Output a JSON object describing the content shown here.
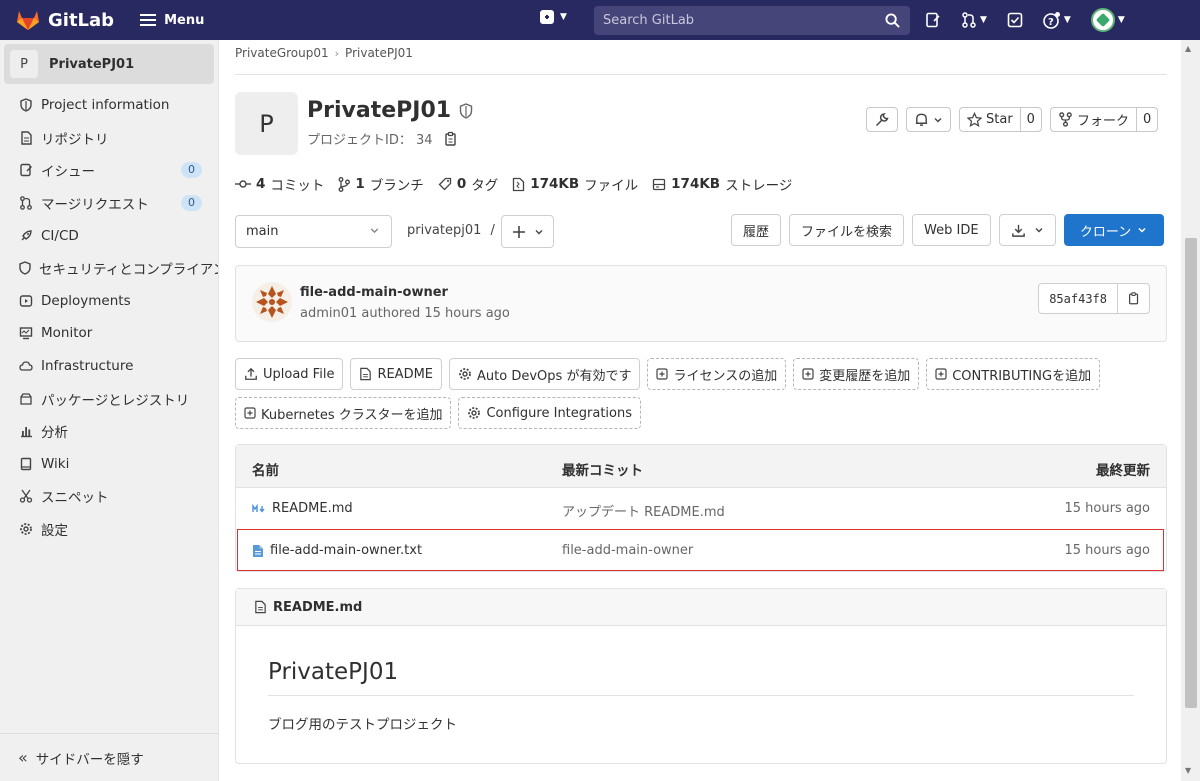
{
  "topbar": {
    "logo_text": "GitLab",
    "menu_label": "Menu",
    "search_placeholder": "Search GitLab",
    "brand_color": "#292961"
  },
  "sidebar": {
    "project_initial": "P",
    "project_name": "PrivatePJ01",
    "items": [
      {
        "label": "Project information",
        "icon": "info-icon"
      },
      {
        "label": "リポジトリ",
        "icon": "doc-icon"
      },
      {
        "label": "イシュー",
        "icon": "issues-icon",
        "count": "0"
      },
      {
        "label": "マージリクエスト",
        "icon": "merge-request-icon",
        "count": "0"
      },
      {
        "label": "CI/CD",
        "icon": "rocket-icon"
      },
      {
        "label": "セキュリティとコンプライアンス",
        "icon": "shield-icon"
      },
      {
        "label": "Deployments",
        "icon": "deploy-icon"
      },
      {
        "label": "Monitor",
        "icon": "monitor-icon"
      },
      {
        "label": "Infrastructure",
        "icon": "cloud-icon"
      },
      {
        "label": "パッケージとレジストリ",
        "icon": "package-icon"
      },
      {
        "label": "分析",
        "icon": "chart-icon"
      },
      {
        "label": "Wiki",
        "icon": "book-icon"
      },
      {
        "label": "スニペット",
        "icon": "scissors-icon"
      },
      {
        "label": "設定",
        "icon": "gear-icon"
      }
    ],
    "hide_label": "サイドバーを隠す"
  },
  "breadcrumb": [
    "PrivateGroup01",
    "PrivatePJ01"
  ],
  "project": {
    "initial": "P",
    "title": "PrivatePJ01",
    "id_label": "プロジェクトID： 34",
    "star_label": "Star",
    "star_count": "0",
    "fork_label": "フォーク",
    "fork_count": "0"
  },
  "stats": {
    "commits": {
      "num": "4",
      "label": "コミット"
    },
    "branches": {
      "num": "1",
      "label": "ブランチ"
    },
    "tags": {
      "num": "0",
      "label": "タグ"
    },
    "files": {
      "num": "174KB",
      "label": "ファイル"
    },
    "storage": {
      "num": "174KB",
      "label": "ストレージ"
    }
  },
  "repo_toolbar": {
    "branch": "main",
    "path": "privatepj01",
    "path_sep": "/",
    "history": "履歴",
    "find_file": "ファイルを検索",
    "web_ide": "Web IDE",
    "clone": "クローン"
  },
  "last_commit": {
    "title": "file-add-main-owner",
    "meta": "admin01 authored 15 hours ago",
    "sha": "85af43f8"
  },
  "quick_actions_row1": [
    {
      "label": "Upload File",
      "icon": "upload-icon",
      "dashed": false
    },
    {
      "label": "README",
      "icon": "file-icon",
      "dashed": false
    },
    {
      "label": "Auto DevOps が有効です",
      "icon": "gear-icon",
      "dashed": false
    },
    {
      "label": "ライセンスの追加",
      "icon": "plus-square-icon",
      "dashed": true
    },
    {
      "label": "変更履歴を追加",
      "icon": "plus-square-icon",
      "dashed": true
    },
    {
      "label": "CONTRIBUTINGを追加",
      "icon": "plus-square-icon",
      "dashed": true
    }
  ],
  "quick_actions_row2": [
    {
      "label": "Kubernetes クラスターを追加",
      "icon": "plus-square-icon",
      "dashed": true
    },
    {
      "label": "Configure Integrations",
      "icon": "gear-icon",
      "dashed": true
    }
  ],
  "file_table": {
    "headers": {
      "name": "名前",
      "commit": "最新コミット",
      "updated": "最終更新"
    },
    "rows": [
      {
        "name": "README.md",
        "icon": "markdown-icon",
        "commit": "アップデート README.md",
        "updated": "15 hours ago"
      },
      {
        "name": "file-add-main-owner.txt",
        "icon": "text-file-icon",
        "commit": "file-add-main-owner",
        "updated": "15 hours ago"
      }
    ]
  },
  "readme": {
    "filename": "README.md",
    "heading": "PrivatePJ01",
    "body": "ブログ用のテストプロジェクト"
  }
}
